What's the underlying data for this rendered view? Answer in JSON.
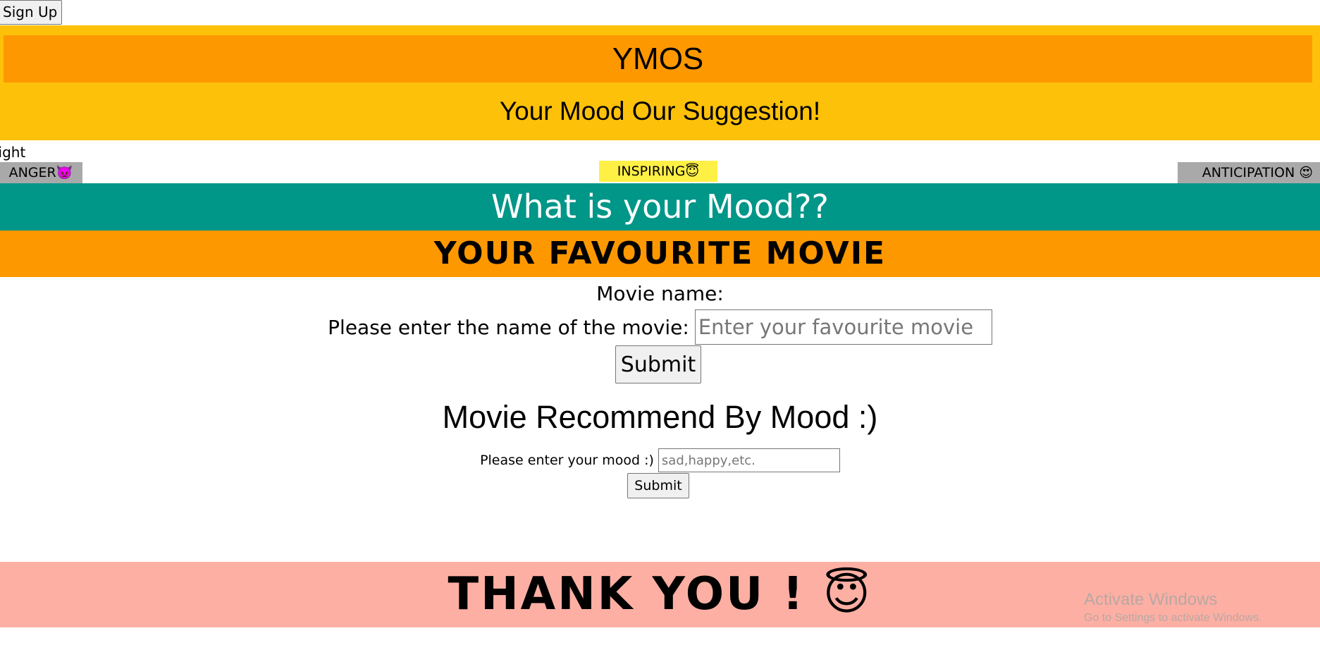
{
  "topbar": {
    "signup_label": "Sign Up"
  },
  "header": {
    "title": "YMOS",
    "subtitle": "Your Mood Our Suggestion!"
  },
  "theme_label": "light",
  "mood_buttons": {
    "anger": "ANGER👿",
    "inspiring": "INSPIRING😇",
    "anticipation": "ANTICIPATION 😍"
  },
  "mood_question": "What is your Mood??",
  "favourite_section": {
    "heading": "YOUR FAVOURITE MOVIE",
    "movie_name_label": "Movie name:",
    "prompt": "Please enter the name of the movie:",
    "input_placeholder": "Enter your favourite movie",
    "input_value": "",
    "submit_label": "Submit"
  },
  "recommend_section": {
    "heading": "Movie Recommend By Mood :)",
    "prompt": "Please enter your mood :)",
    "input_placeholder": "sad,happy,etc.",
    "input_value": "",
    "submit_label": "Submit"
  },
  "footer": {
    "thank_you": "THANK YOU ! 😇"
  },
  "watermark": {
    "title": "Activate Windows",
    "subtitle": "Go to Settings to activate Windows."
  },
  "colors": {
    "header_band": "#fdc10a",
    "header_title_bar": "#fe9800",
    "mood_question_bar": "#009688",
    "favourite_bar": "#fe9800",
    "footer_band": "#fdafa3",
    "inspiring_button": "#fff046",
    "side_buttons": "#a9a9a9"
  }
}
